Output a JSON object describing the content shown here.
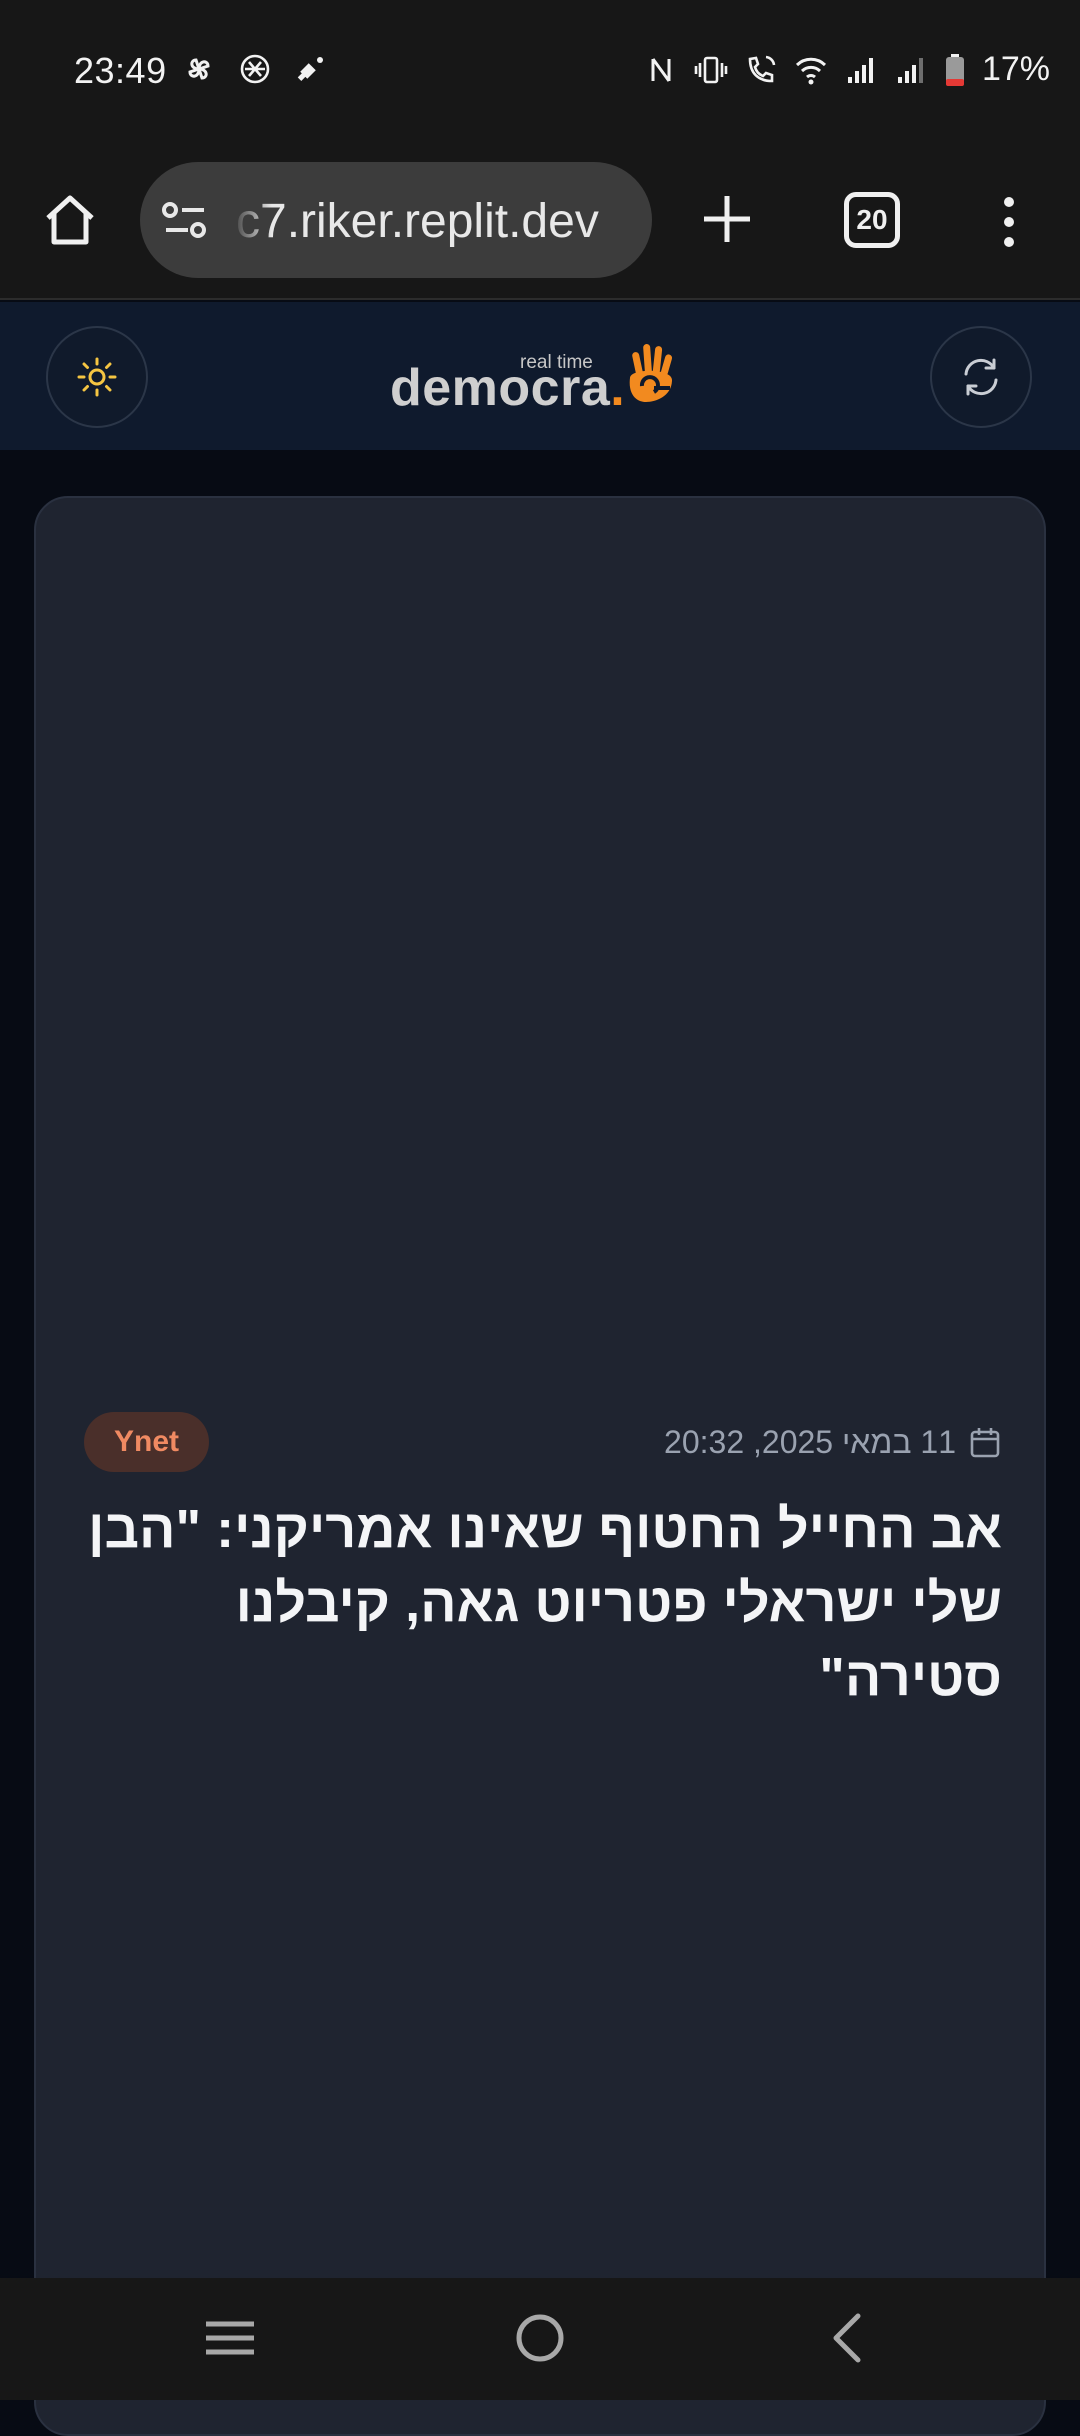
{
  "status_bar": {
    "time": "23:49",
    "battery_percent": "17%",
    "left_icons": [
      "pinwheel-icon",
      "openai-icon",
      "satellite-icon"
    ],
    "right_icons": [
      "nfc-icon",
      "vibrate-icon",
      "wifi-call-icon",
      "wifi-icon",
      "signal-icon",
      "signal-icon",
      "battery-icon"
    ]
  },
  "browser": {
    "url": "c7.riker.replit.dev",
    "tab_count": "20"
  },
  "app_header": {
    "logo_small": "real time",
    "logo_main": "democra",
    "logo_dot": ".",
    "brand_color": "#f28a1f"
  },
  "article": {
    "source": "Ynet",
    "date": "11 במאי 2025, 20:32",
    "headline": "אב החייל החטוף שאינו אמריקני: \"הבן שלי ישראלי פטריוט גאה, קיבלנו סטירה\""
  },
  "nav_bar": {
    "buttons": [
      "recents",
      "home",
      "back"
    ]
  }
}
